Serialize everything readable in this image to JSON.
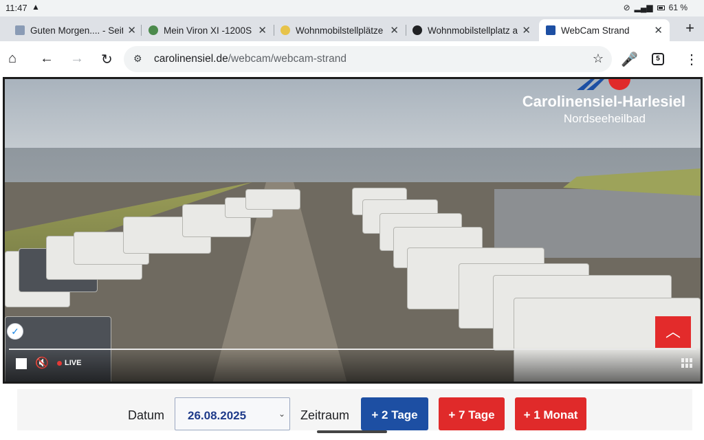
{
  "status": {
    "time": "11:47",
    "battery": "61 %"
  },
  "tabs": [
    {
      "title": "Guten Morgen.... - Seite",
      "fav_color": "#8a9bb5",
      "active": false
    },
    {
      "title": "Mein Viron XI -1200S -",
      "fav_color": "#4c8a4c",
      "active": false
    },
    {
      "title": "Wohnmobilstellplätze a",
      "fav_color": "#e7c34a",
      "active": false
    },
    {
      "title": "Wohnmobilstellplatz an",
      "fav_color": "#202124",
      "active": false
    },
    {
      "title": "WebCam Strand",
      "fav_color": "#1d4fa3",
      "active": true
    }
  ],
  "toolbar": {
    "url_host": "carolinensiel.de",
    "url_path": "/webcam/webcam-strand",
    "tab_count": "5"
  },
  "webcam": {
    "logo_title": "Carolinensiel-Harlesiel",
    "logo_subtitle": "Nordseeheilbad",
    "live_label": "LIVE"
  },
  "controls": {
    "datum_label": "Datum",
    "date_value": "26.08.2025",
    "zeitraum_label": "Zeitraum",
    "btn_2_days": "+ 2 Tage",
    "btn_7_days": "+ 7 Tage",
    "btn_1_month": "+ 1 Monat"
  },
  "colors": {
    "accent_blue": "#1d4fa3",
    "accent_red": "#e02a2a"
  }
}
